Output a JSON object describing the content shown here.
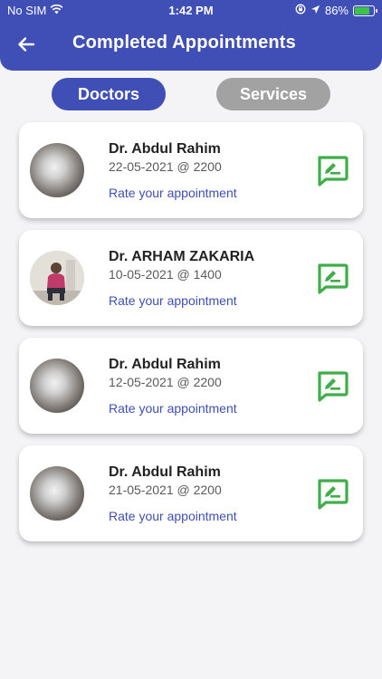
{
  "status_bar": {
    "carrier": "No SIM",
    "time": "1:42 PM",
    "battery_percent": "86%",
    "battery_level": 0.86,
    "icons": [
      "wifi-icon",
      "orientation-lock-icon",
      "location-arrow-icon",
      "battery-charging-icon"
    ]
  },
  "header": {
    "title": "Completed Appointments",
    "back_icon": "back-arrow-icon",
    "color": "#3f4fb5"
  },
  "tabs": [
    {
      "label": "Doctors",
      "active": true,
      "color": "#3f4fb5"
    },
    {
      "label": "Services",
      "active": false,
      "color": "#a2a2a2"
    }
  ],
  "appointments": [
    {
      "name": "Dr. Abdul Rahim",
      "datetime": "22-05-2021 @ 2200",
      "action": "Rate your appointment",
      "avatar": "blurred-photo"
    },
    {
      "name": "Dr. ARHAM ZAKARIA",
      "datetime": "10-05-2021 @ 1400",
      "action": "Rate your appointment",
      "avatar": "person-photo"
    },
    {
      "name": "Dr. Abdul Rahim",
      "datetime": "12-05-2021 @ 2200",
      "action": "Rate your appointment",
      "avatar": "blurred-photo"
    },
    {
      "name": "Dr. Abdul Rahim",
      "datetime": "21-05-2021 @ 2200",
      "action": "Rate your appointment",
      "avatar": "blurred-photo"
    }
  ],
  "colors": {
    "accent": "#3f4fb5",
    "rate_icon": "#3fae49",
    "background": "#f4f4f6"
  }
}
